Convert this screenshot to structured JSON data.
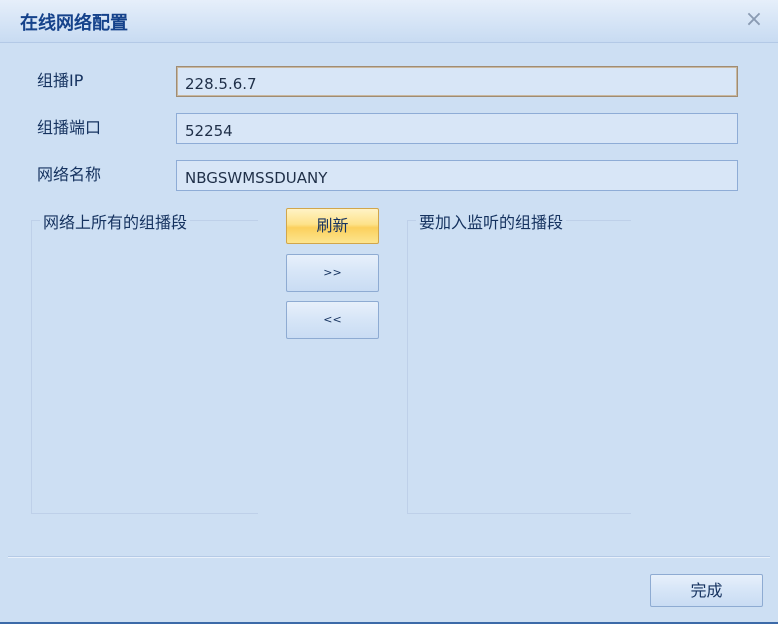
{
  "window": {
    "title": "在线网络配置",
    "close_glyph": "×"
  },
  "form": {
    "multicast_ip": {
      "label": "组播IP",
      "value": "228.5.6.7"
    },
    "multicast_port": {
      "label": "组播端口",
      "value": "52254"
    },
    "network_name": {
      "label": "网络名称",
      "value": "NBGSWMSSDUANY"
    }
  },
  "available_segments": {
    "title": "网络上所有的组播段",
    "items": []
  },
  "selected_segments": {
    "title": "要加入监听的组播段",
    "items": []
  },
  "actions": {
    "refresh_label": "刷新",
    "add_label": ">>",
    "remove_label": "<<",
    "done_label": "完成"
  },
  "colors": {
    "title_text": "#15428b",
    "refresh_highlight": "#fbd05d",
    "background": "#cddff3"
  }
}
